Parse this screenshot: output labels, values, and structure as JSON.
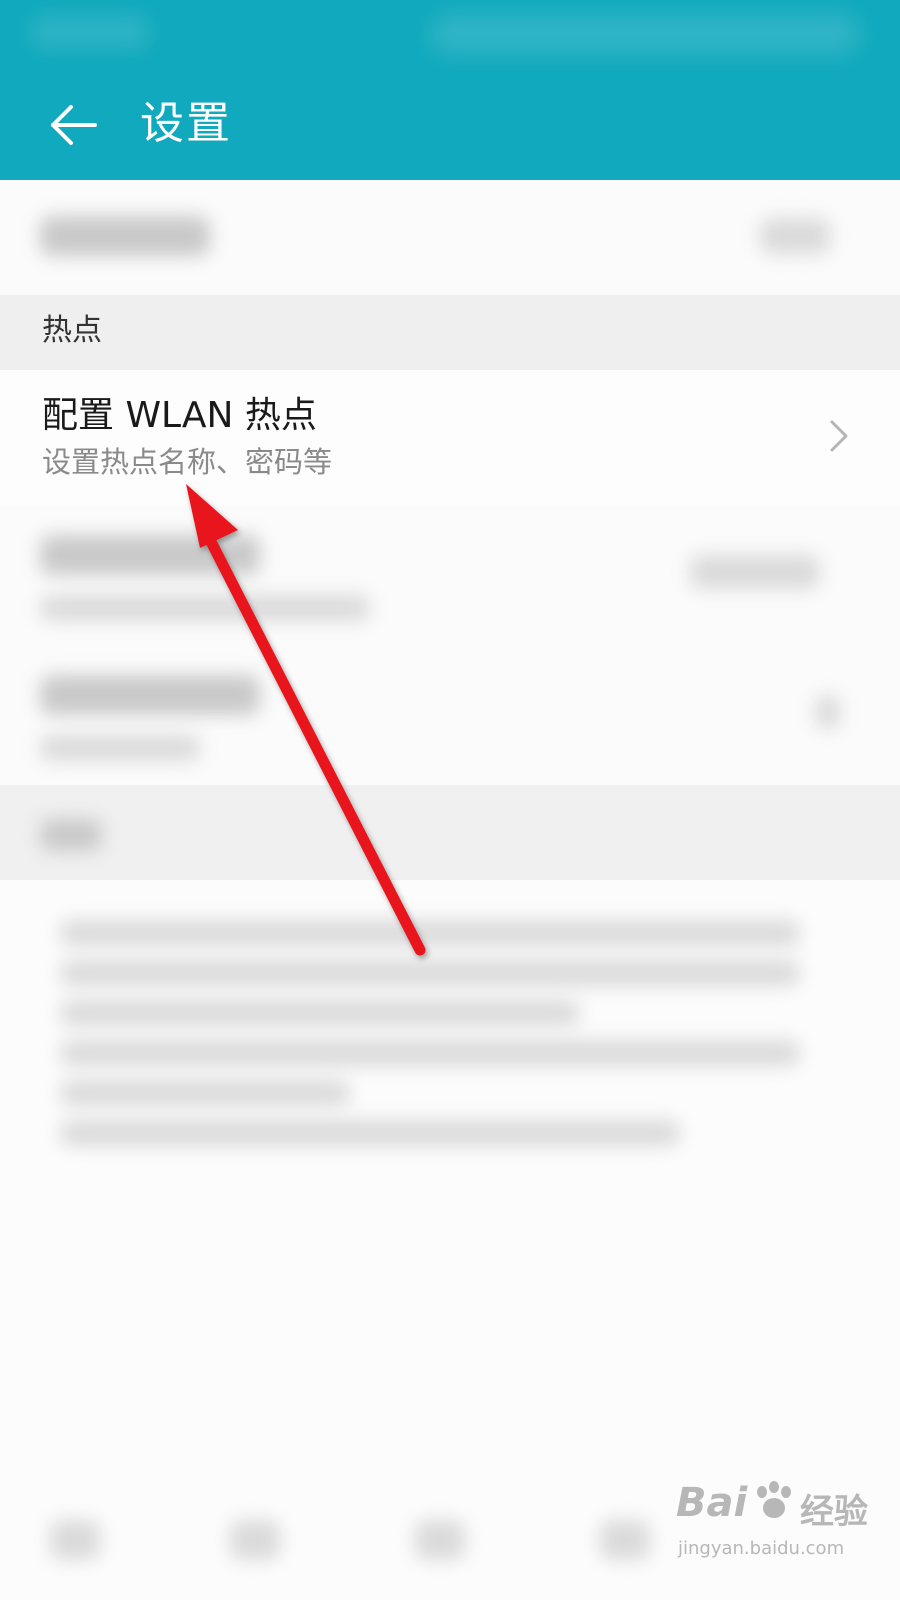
{
  "header": {
    "title": "设置",
    "accent_color": "#10a9bd",
    "back_icon": "back-arrow-icon"
  },
  "hotspot_section": {
    "title": "热点",
    "item": {
      "title": "配置 WLAN 热点",
      "subtitle": "设置热点名称、密码等",
      "chevron_icon": "chevron-right-icon"
    }
  },
  "annotation": {
    "arrow_color": "#e8141c"
  },
  "watermark": {
    "brand_left": "Bai",
    "brand_right": "经验",
    "url": "jingyan.baidu.com"
  }
}
